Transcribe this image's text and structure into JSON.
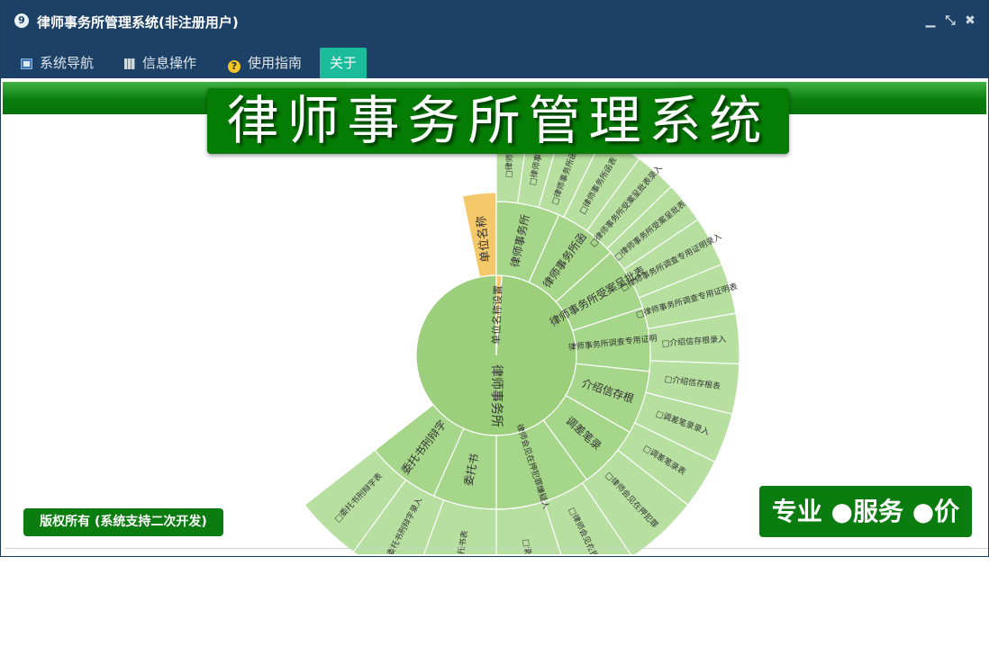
{
  "window": {
    "title": "律师事务所管理系统(非注册用户)",
    "app_icon_text": "9",
    "controls": [
      "minimize",
      "restore",
      "close"
    ]
  },
  "menu": {
    "items": [
      {
        "label": "系统导航",
        "icon": "monitor-icon"
      },
      {
        "label": "信息操作",
        "icon": "grid-icon"
      },
      {
        "label": "使用指南",
        "icon": "help-icon"
      },
      {
        "label": "关于",
        "icon": ""
      }
    ]
  },
  "banner": {
    "title": "律师事务所管理系统"
  },
  "copyright": "版权所有 (系统支持二次开发)",
  "slogan": "专业 ●服务 ●价值",
  "sunburst": {
    "root_label": "律师事务所",
    "unit_label": "单位名称设置",
    "unit_outer_label": "单位名称",
    "level2": [
      "律师事务所",
      "律师事务所函",
      "律师事务所受案呈批表",
      "律师事务所调查专用证明",
      "介绍信存根",
      "调差笔录",
      "律师会见在押犯罪嫌疑人",
      "委托书",
      "委托书刑辩字"
    ],
    "level3": [
      "□律师事务",
      "□律师事务所",
      "□律师事务所函录入",
      "□律师事务所函表",
      "□律师事务所受案呈批表录入",
      "□律师事务所受案呈批表",
      "□律师事务所调查专用证明录入",
      "□律师事务所调查专用证明表",
      "□介绍信存根录入",
      "□介绍信存根表",
      "□调差笔录录入",
      "□调差笔录表",
      "□律师会见在押犯罪",
      "□律师会见在押",
      "□录入",
      "□委托书表",
      "□委托书刑辩字录入",
      "□委托书刑辩字表"
    ],
    "colors": {
      "root": "#9ccf7b",
      "level2": "#a6d68a",
      "level3": "#b6dfa0",
      "unit": "#f5c86a"
    }
  }
}
